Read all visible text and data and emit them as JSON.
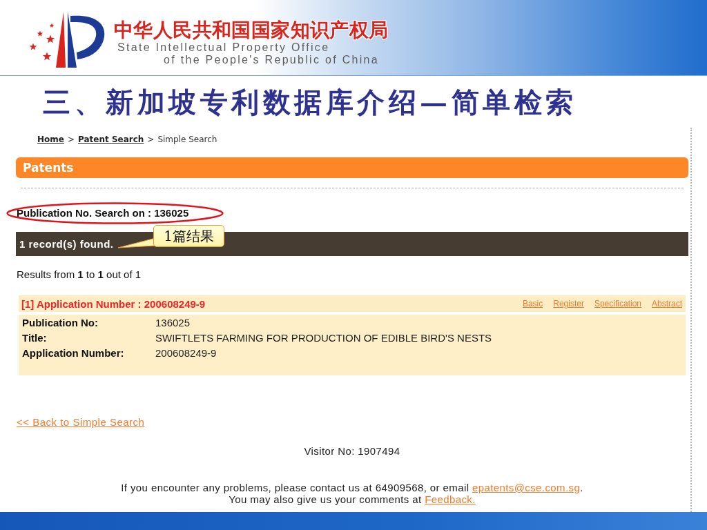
{
  "header": {
    "org_name_cn": "中华人民共和国国家知识产权局",
    "org_name_en": [
      "State Intellectual Property Office",
      "of the People's Republic of China"
    ]
  },
  "slide_title": "三、新加坡专利数据库介绍—简单检索",
  "page": {
    "breadcrumb": [
      {
        "kind": "link",
        "label": "Home"
      },
      {
        "kind": "separator",
        "label": ">"
      },
      {
        "kind": "link",
        "label": "Patent Search"
      },
      {
        "kind": "separator",
        "label": ">"
      },
      {
        "kind": "current",
        "label": "Simple Search"
      }
    ],
    "section_title": "Patents",
    "search_summary": {
      "text": "Publication No. Search on : 136025",
      "circled": true
    },
    "records_bar": {
      "text": "1 record(s) found.",
      "callout": "1篇结果"
    },
    "results_range": "Results from **1** to **1** out of 1",
    "results": [
      {
        "heading": "[1] Application Number : 200608249-9",
        "links": [
          "Basic",
          "Register",
          "Specification",
          "Abstract"
        ],
        "fields": [
          {
            "label": "Publication No:",
            "value": "136025"
          },
          {
            "label": "Title:",
            "value": "SWIFTLETS FARMING FOR PRODUCTION OF EDIBLE BIRD'S NESTS"
          },
          {
            "label": "Application Number:",
            "value": "200608249-9"
          }
        ]
      }
    ],
    "back_link": "<< Back to Simple Search",
    "visitor": "Visitor No: 1907494",
    "footer": [
      [
        {
          "kind": "text",
          "text": "If you encounter any problems, please contact us at 64909568, or email "
        },
        {
          "kind": "link",
          "text": "epatents@cse.com.sg"
        },
        {
          "kind": "text",
          "text": "."
        }
      ],
      [
        {
          "kind": "text",
          "text": "You may also give us your comments at "
        },
        {
          "kind": "link",
          "text": "Feedback."
        }
      ]
    ]
  }
}
